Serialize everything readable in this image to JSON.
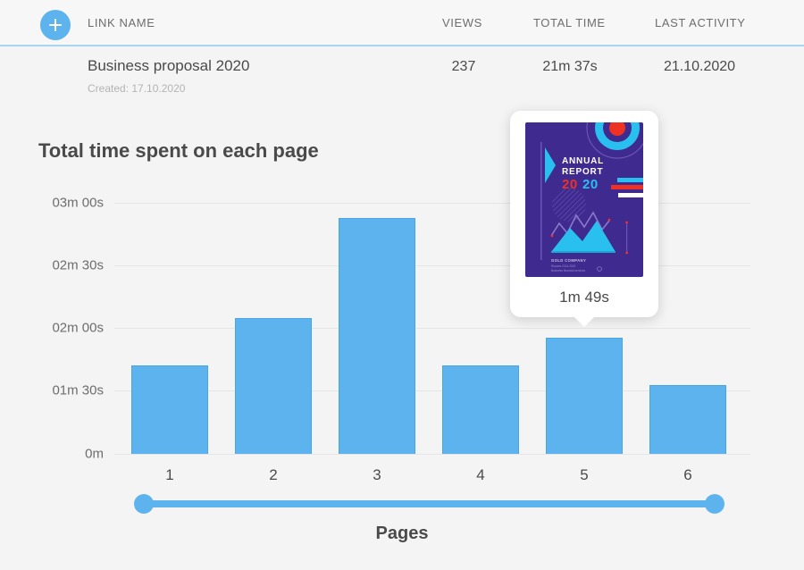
{
  "table": {
    "add_button_icon": "plus-icon",
    "columns": [
      "LINK NAME",
      "VIEWS",
      "TOTAL TIME",
      "LAST ACTIVITY"
    ],
    "rows": [
      {
        "name": "Business proposal 2020",
        "created": "Created: 17.10.2020",
        "views": "237",
        "total_time": "21m 37s",
        "last_activity": "21.10.2020"
      }
    ]
  },
  "chart_title": "Total time spent on each page",
  "tooltip": {
    "value": "1m 49s",
    "thumbnail": {
      "line1": "ANNUAL",
      "line2": "REPORT",
      "year": "2020",
      "company": "GOLD COMPANY",
      "sub1": "Reports 2014-2020",
      "sub2": "Business financial services"
    }
  },
  "slider": {
    "left_handle": "range-start-handle",
    "right_handle": "range-end-handle",
    "start": 1,
    "end": 6
  },
  "colors": {
    "accent": "#5cb3ee",
    "bar": "#5cb3ee",
    "bar_border": "#49a6e6",
    "background": "#f4f4f4",
    "header_rule": "#a9d4f2",
    "grid": "#e6e6e6",
    "text": "#4a4a4a",
    "muted": "#b4b4b4"
  },
  "chart_data": {
    "type": "bar",
    "title": "Total time spent on each page",
    "xlabel": "Pages",
    "ylabel": "",
    "categories": [
      "1",
      "2",
      "3",
      "4",
      "5",
      "6"
    ],
    "values": [
      98,
      141,
      188,
      98,
      122,
      83
    ],
    "value_labels": [
      "1m 38s",
      "2m 21s",
      "3m 08s",
      "1m 38s",
      "2m 02s",
      "1m 23s"
    ],
    "units": "seconds",
    "ytick_labels": [
      "03m 00s",
      "02m 30s",
      "02m 00s",
      "01m 30s",
      "0m"
    ],
    "ytick_values": [
      180,
      150,
      120,
      90,
      0
    ],
    "grid": true,
    "legend": false,
    "highlighted_category": "5",
    "highlight_value_label": "1m 49s"
  }
}
